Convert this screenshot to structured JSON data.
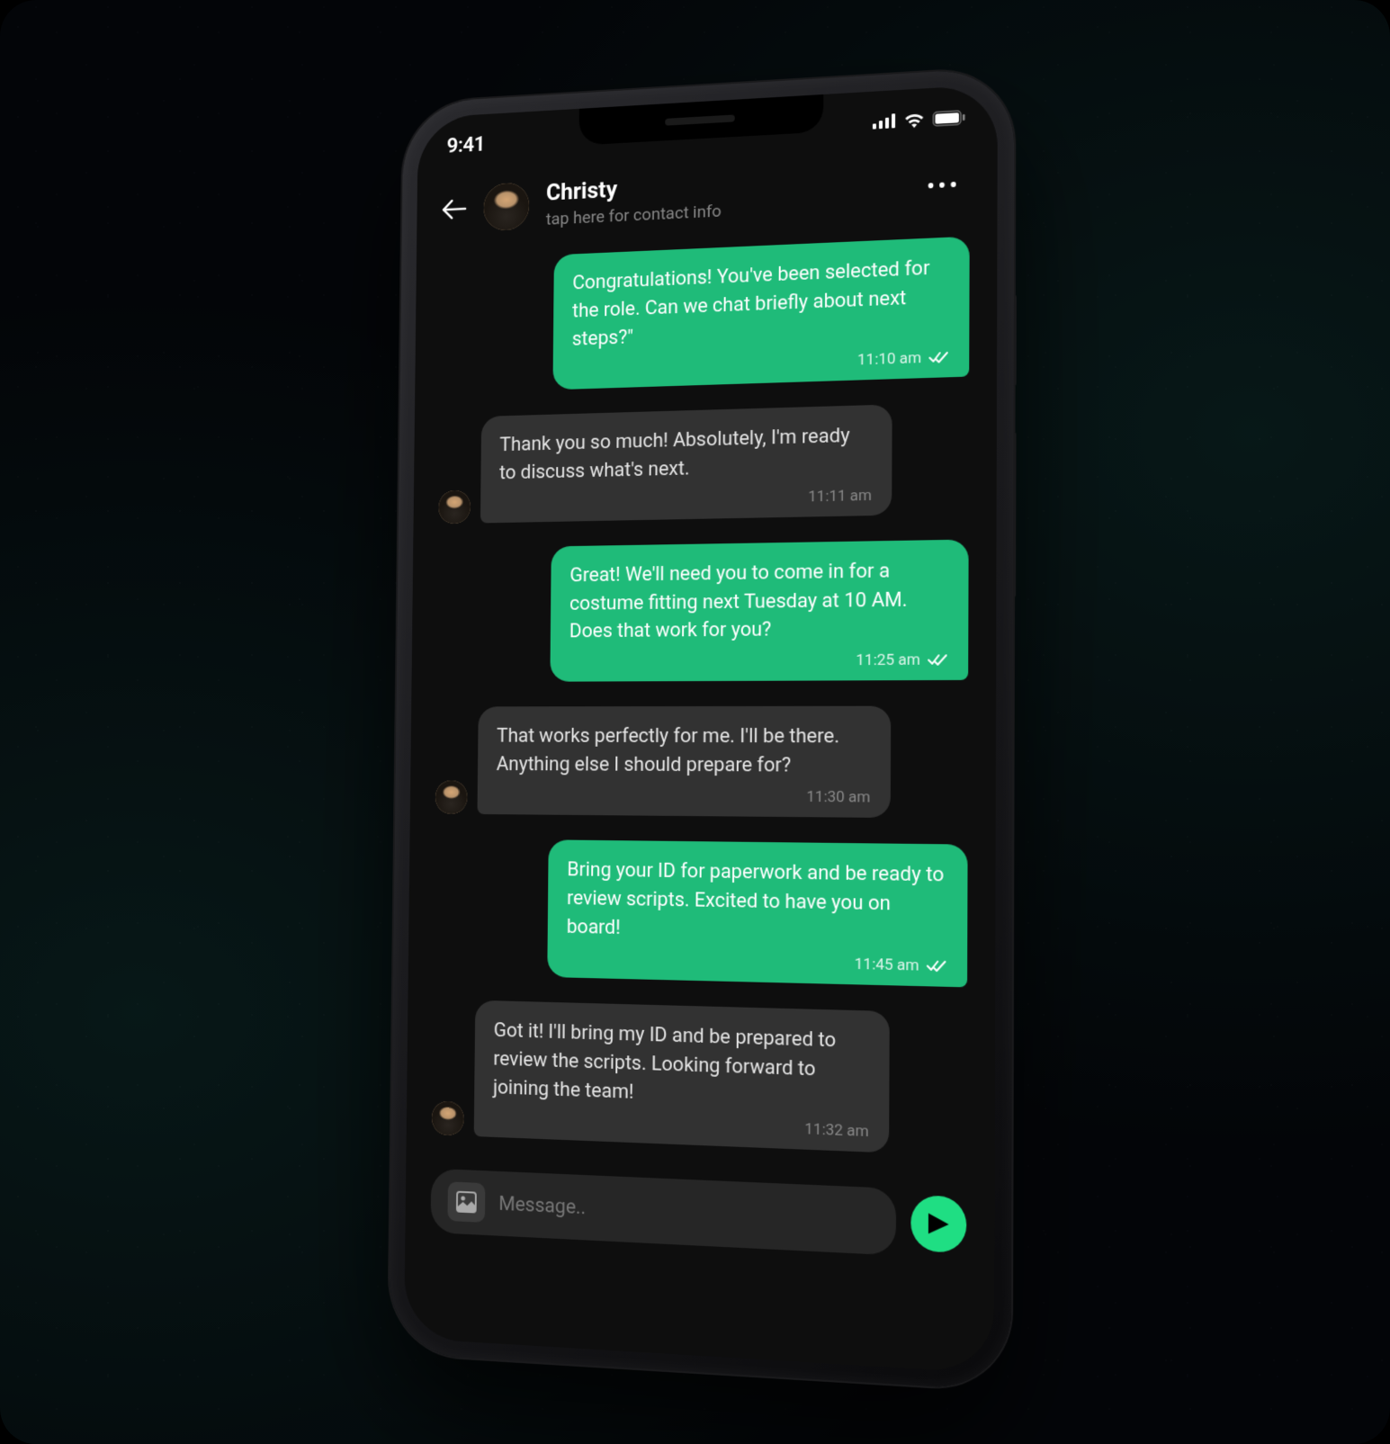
{
  "status": {
    "time": "9:41"
  },
  "header": {
    "contact_name": "Christy",
    "contact_subtitle": "tap here for contact info"
  },
  "messages": [
    {
      "direction": "outgoing",
      "text": "Congratulations! You've been selected for the role. Can we chat briefly about next steps?\"",
      "time": "11:10 am",
      "read": true
    },
    {
      "direction": "incoming",
      "text": "Thank you so much! Absolutely, I'm ready to discuss what's next.",
      "time": "11:11 am"
    },
    {
      "direction": "outgoing",
      "text": "Great! We'll need you to come in for a costume fitting next Tuesday at 10 AM. Does that work for you?",
      "time": "11:25 am",
      "read": true
    },
    {
      "direction": "incoming",
      "text": "That works perfectly for me. I'll be there. Anything else I should prepare for?",
      "time": "11:30 am"
    },
    {
      "direction": "outgoing",
      "text": "Bring your ID for paperwork and be ready to review scripts. Excited to have you on board!",
      "time": "11:45 am",
      "read": true
    },
    {
      "direction": "incoming",
      "text": "Got it! I'll bring my ID and be prepared to review the scripts. Looking forward to joining the team!",
      "time": "11:32 am"
    }
  ],
  "input": {
    "placeholder": "Message.."
  }
}
